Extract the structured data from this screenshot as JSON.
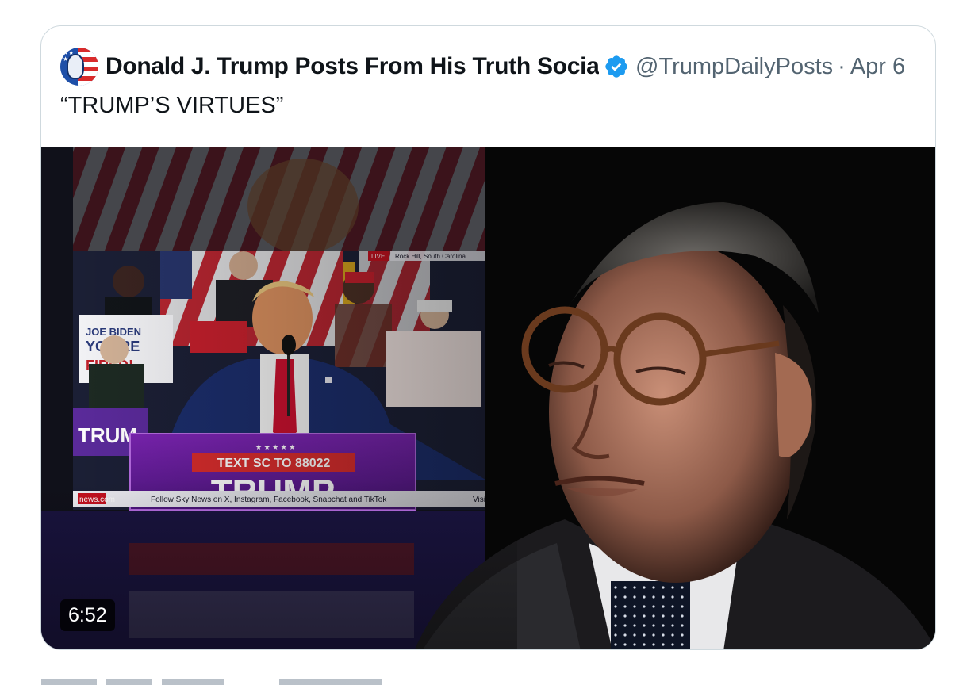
{
  "quote": {
    "author_name": "Donald J. Trump Posts From His Truth Socia",
    "handle": "@TrumpDailyPosts",
    "separator": "·",
    "date": "Apr 6",
    "text": "“TRUMP’S VIRTUES”",
    "verified": true
  },
  "media": {
    "duration": "6:52",
    "broadcast": {
      "live_label": "LIVE",
      "location": "Rock Hill, South Carolina",
      "podium_sms": "TEXT SC TO 88022",
      "podium_name": "TRUMP",
      "ticker_source": "news.com",
      "ticker_text": "Follow Sky News on X, Instagram, Facebook, Snapchat and TikTok",
      "ticker_tail": "Visit",
      "crowd_sign": "JOE BIDEN YOU'RE FIRED!"
    }
  },
  "colors": {
    "verified_blue": "#1d9bf0",
    "name_text": "#0f1419",
    "meta_text": "#536471",
    "card_border": "#cfd9de",
    "podium_purple": "#6a1fa0",
    "podium_red": "#d72c2c",
    "suit_navy": "#1b2d6b",
    "tie_red": "#c8102e"
  },
  "icons": {
    "verified": "verified-badge-icon",
    "avatar": "profile-avatar"
  }
}
